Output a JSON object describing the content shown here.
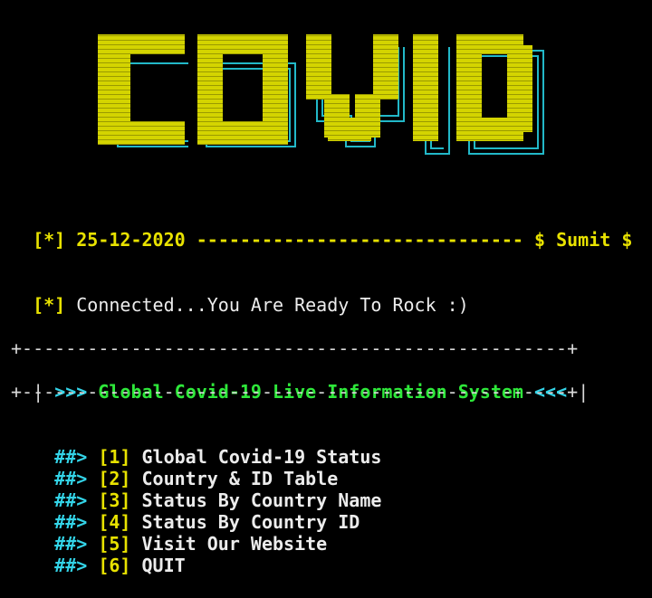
{
  "banner": {
    "text": "COVID",
    "fill_color": "#d4d400",
    "shadow_color": "#22b8c8"
  },
  "info": {
    "date_prefix": "[*]",
    "date": "25-12-2020",
    "separator": "------------------------------",
    "author": "$ Sumit $"
  },
  "status": {
    "prefix": "[*]",
    "message": "Connected...You Are Ready To Rock :)"
  },
  "header_box": {
    "top_border": "+--------------------------------------------------+",
    "left_edge": "|",
    "open_marker": ">>>",
    "title": "Global Covid-19 Live Information System",
    "close_marker": "<<<",
    "right_edge": "|",
    "bottom_border": "+--------------------------------------------------+"
  },
  "menu": {
    "arrow": "##>",
    "items": [
      {
        "key": "[1]",
        "label": "Global Covid-19 Status"
      },
      {
        "key": "[2]",
        "label": "Country & ID Table"
      },
      {
        "key": "[3]",
        "label": "Status By Country Name"
      },
      {
        "key": "[4]",
        "label": "Status By Country ID"
      },
      {
        "key": "[5]",
        "label": "Visit Our Website"
      },
      {
        "key": "[6]",
        "label": "QUIT"
      }
    ]
  },
  "colors": {
    "background": "#000000",
    "yellow": "#e8e200",
    "green": "#2ee83a",
    "cyan": "#33d4e8",
    "text": "#ececec"
  }
}
